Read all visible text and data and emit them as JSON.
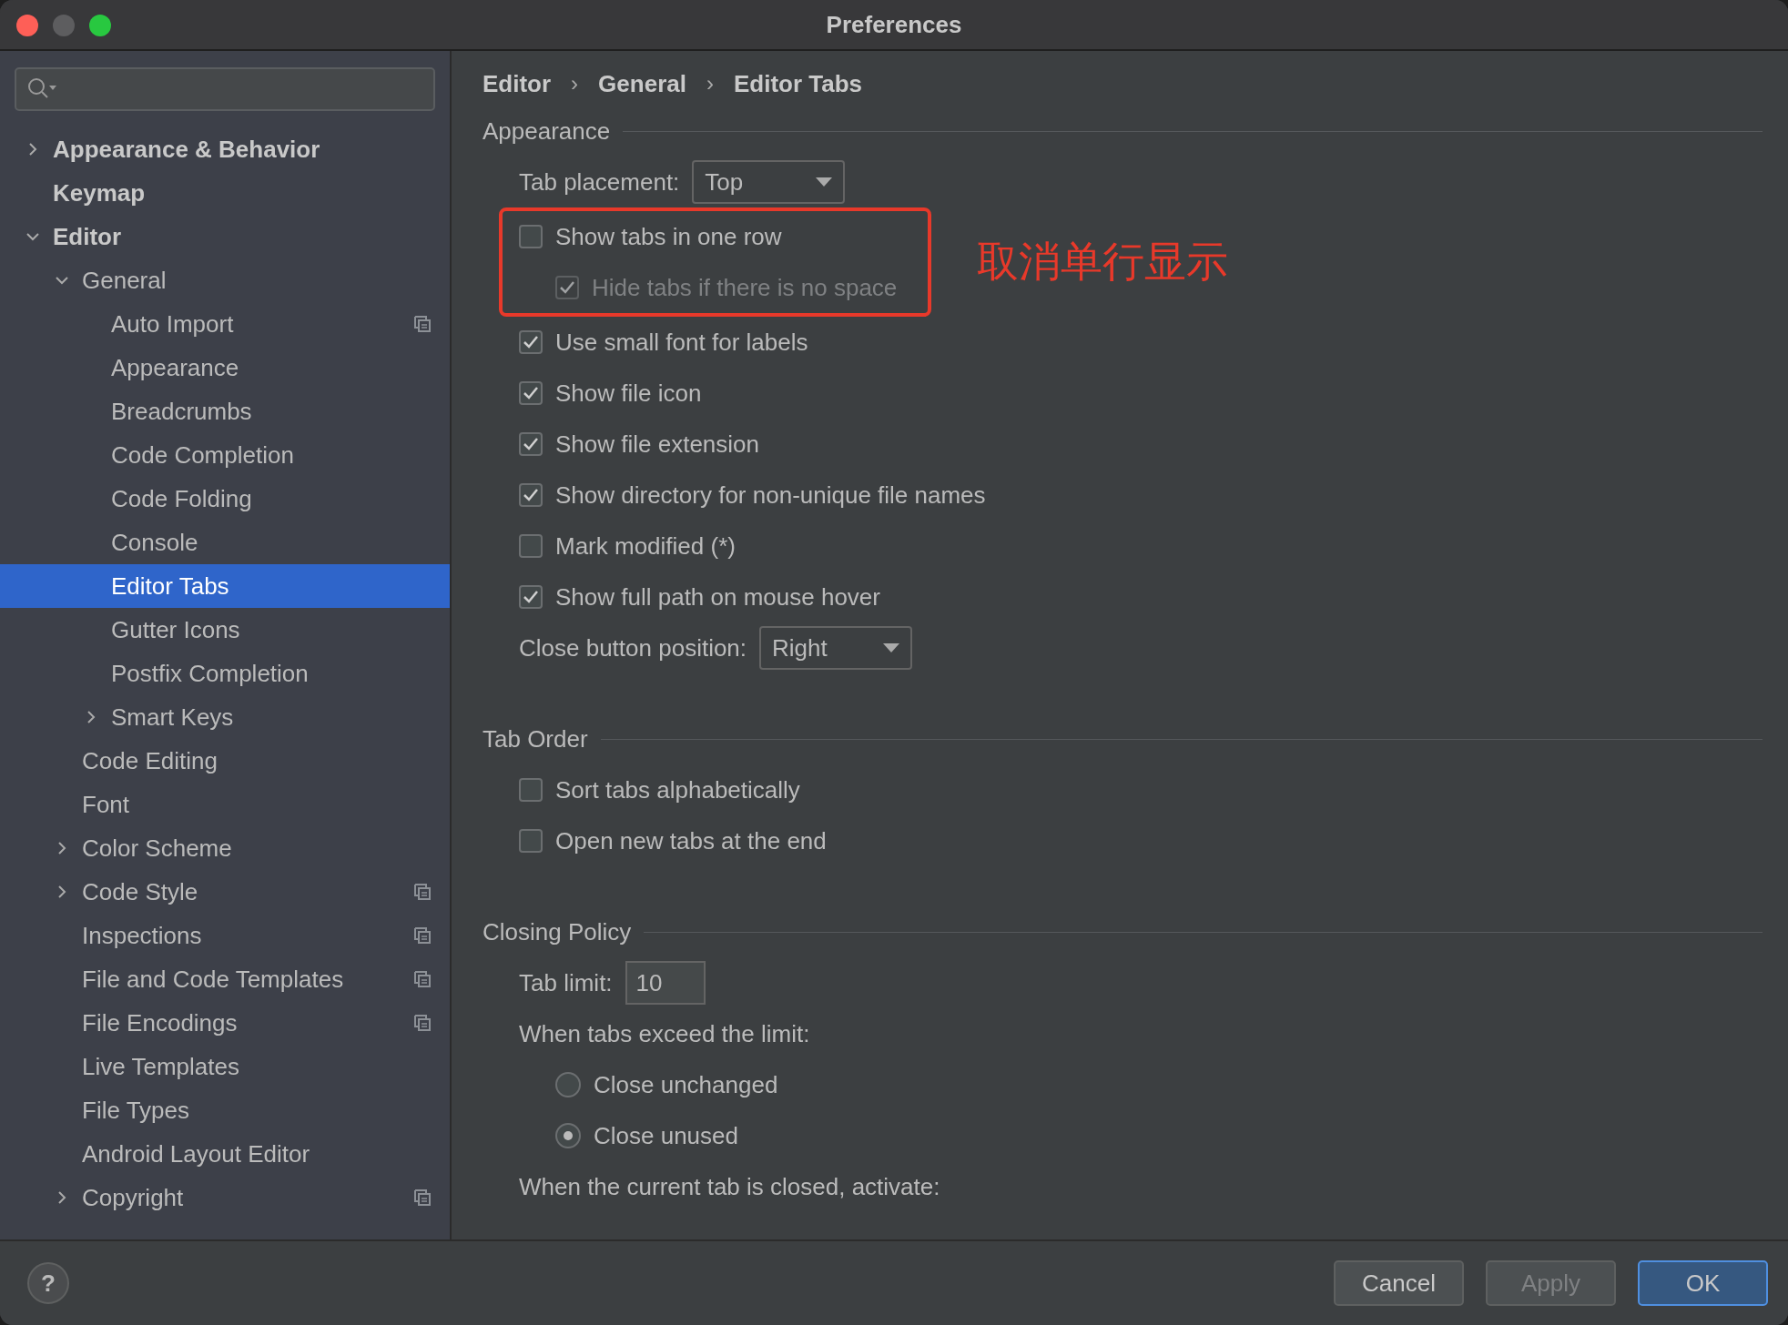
{
  "window": {
    "title": "Preferences"
  },
  "sidebar": {
    "items": [
      {
        "label": "Appearance & Behavior",
        "bold": true,
        "expanded": false,
        "selected": false
      },
      {
        "label": "Keymap",
        "bold": true,
        "selected": false
      },
      {
        "label": "Editor",
        "bold": true,
        "expanded": true,
        "selected": false,
        "children": [
          {
            "label": "General",
            "expanded": true,
            "selected": false,
            "children": [
              {
                "label": "Auto Import",
                "scoped": true,
                "selected": false
              },
              {
                "label": "Appearance",
                "selected": false
              },
              {
                "label": "Breadcrumbs",
                "selected": false
              },
              {
                "label": "Code Completion",
                "selected": false
              },
              {
                "label": "Code Folding",
                "selected": false
              },
              {
                "label": "Console",
                "selected": false
              },
              {
                "label": "Editor Tabs",
                "selected": true
              },
              {
                "label": "Gutter Icons",
                "selected": false
              },
              {
                "label": "Postfix Completion",
                "selected": false
              },
              {
                "label": "Smart Keys",
                "expanded": false,
                "selected": false
              }
            ]
          },
          {
            "label": "Code Editing",
            "selected": false
          },
          {
            "label": "Font",
            "selected": false
          },
          {
            "label": "Color Scheme",
            "expanded": false,
            "selected": false
          },
          {
            "label": "Code Style",
            "expanded": false,
            "scoped": true,
            "selected": false
          },
          {
            "label": "Inspections",
            "scoped": true,
            "selected": false
          },
          {
            "label": "File and Code Templates",
            "scoped": true,
            "selected": false
          },
          {
            "label": "File Encodings",
            "scoped": true,
            "selected": false
          },
          {
            "label": "Live Templates",
            "selected": false
          },
          {
            "label": "File Types",
            "selected": false
          },
          {
            "label": "Android Layout Editor",
            "selected": false
          },
          {
            "label": "Copyright",
            "expanded": false,
            "scoped": true,
            "selected": false
          }
        ]
      }
    ]
  },
  "breadcrumbs": [
    {
      "label": "Editor",
      "separator": "›"
    },
    {
      "label": "General",
      "separator": "›"
    },
    {
      "label": "Editor Tabs"
    }
  ],
  "sections": [
    {
      "title": "Appearance",
      "items": [
        {
          "kind": "select",
          "label": "Tab placement:",
          "value": "Top"
        },
        {
          "kind": "highlight",
          "note": "取消单行显示",
          "items": [
            {
              "kind": "checkbox",
              "label": "Show tabs in one row",
              "checked": false,
              "disabled": false
            },
            {
              "kind": "checkbox",
              "label": "Hide tabs if there is no space",
              "checked": true,
              "disabled": true,
              "nested": true
            }
          ]
        },
        {
          "kind": "checkbox",
          "label": "Use small font for labels",
          "checked": true,
          "disabled": false
        },
        {
          "kind": "checkbox",
          "label": "Show file icon",
          "checked": true,
          "disabled": false
        },
        {
          "kind": "checkbox",
          "label": "Show file extension",
          "checked": true,
          "disabled": false
        },
        {
          "kind": "checkbox",
          "label": "Show directory for non-unique file names",
          "checked": true,
          "disabled": false
        },
        {
          "kind": "checkbox",
          "label": "Mark modified (*)",
          "checked": false,
          "disabled": false
        },
        {
          "kind": "checkbox",
          "label": "Show full path on mouse hover",
          "checked": true,
          "disabled": false
        },
        {
          "kind": "select",
          "label": "Close button position:",
          "value": "Right"
        }
      ]
    },
    {
      "title": "Tab Order",
      "items": [
        {
          "kind": "checkbox",
          "label": "Sort tabs alphabetically",
          "checked": false,
          "disabled": false
        },
        {
          "kind": "checkbox",
          "label": "Open new tabs at the end",
          "checked": false,
          "disabled": false
        }
      ]
    },
    {
      "title": "Closing Policy",
      "items": [
        {
          "kind": "input",
          "label": "Tab limit:",
          "value": "10"
        },
        {
          "kind": "text",
          "label": "When tabs exceed the limit:"
        },
        {
          "kind": "radio",
          "label": "Close unchanged",
          "selected": false
        },
        {
          "kind": "radio",
          "label": "Close unused",
          "selected": true
        },
        {
          "kind": "text",
          "label": "When the current tab is closed, activate:"
        }
      ]
    }
  ],
  "help": {
    "label": "?"
  },
  "buttons": [
    {
      "label": "Cancel",
      "kind": "default",
      "disabled": false
    },
    {
      "label": "Apply",
      "kind": "default",
      "disabled": true
    },
    {
      "label": "OK",
      "kind": "primary",
      "disabled": false
    }
  ]
}
